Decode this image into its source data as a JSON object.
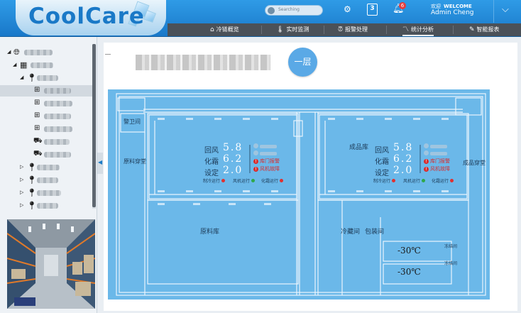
{
  "app": {
    "logo": "CoolCare"
  },
  "header": {
    "search_placeholder": "Searching",
    "calendar_day": "3",
    "notification_count": "6",
    "welcome_cn": "欢迎",
    "welcome_en": "WELCOME",
    "user_name": "Admin Cheng"
  },
  "nav": {
    "items": [
      {
        "label": "冷链概览",
        "icon": "home-icon"
      },
      {
        "label": "实时监测",
        "icon": "thermometer-icon"
      },
      {
        "label": "报警处理",
        "icon": "alarm-clock-icon"
      },
      {
        "label": "统计分析",
        "icon": "trend-chart-icon",
        "active": true
      },
      {
        "label": "智能报表",
        "icon": "report-edit-icon"
      }
    ]
  },
  "main": {
    "floor_button": "一层"
  },
  "plan": {
    "rooms": {
      "guard": "警卫间",
      "raw_dressing": "原料穿堂",
      "finished_store": "成品库",
      "finished_dressing": "成品穿堂",
      "raw_store": "原料库",
      "cold_room": "冷藏间",
      "packing_room": "包装间",
      "freezer1": "冻结间",
      "freezer2": "冻结间"
    },
    "left_panel": {
      "return_air_label": "回风",
      "return_air_value": "5.8",
      "defrost_label": "化霜",
      "defrost_value": "6.2",
      "setpoint_label": "设定",
      "setpoint_value": "2.0",
      "alarm_door": "库门报警",
      "alarm_fan": "风机故障",
      "status_cooling": "制冷运行",
      "status_fan": "风机运行",
      "status_defrost": "化霜运行"
    },
    "right_panel": {
      "return_air_label": "回风",
      "return_air_value": "5.8",
      "defrost_label": "化霜",
      "defrost_value": "6.2",
      "setpoint_label": "设定",
      "setpoint_value": "2.0",
      "alarm_door": "库门报警",
      "alarm_fan": "风机故障",
      "status_cooling": "制冷运行",
      "status_fan": "风机运行",
      "status_defrost": "化霜运行"
    },
    "freezer_temp_1": "-30℃",
    "freezer_temp_2": "-30℃"
  },
  "colors": {
    "header": "#1f86d4",
    "nav": "#4b5158",
    "plan": "#6bb8e9",
    "floor_button": "#5aa9e6",
    "alarm": "#d92d2d",
    "status_green": "#2ea84a",
    "status_red": "#e03030"
  }
}
